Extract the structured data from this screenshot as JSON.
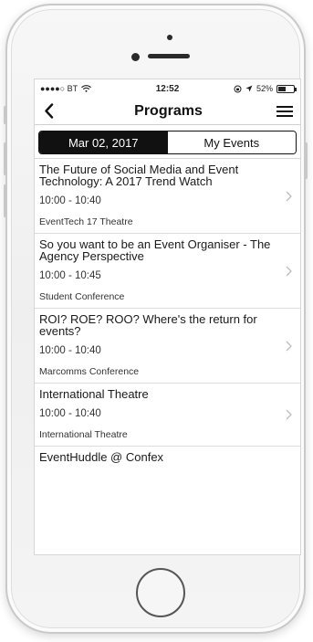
{
  "status_bar": {
    "carrier": "●●●●○ BT",
    "time": "12:52",
    "battery_percent": "52%",
    "battery_level": 0.52
  },
  "nav": {
    "title": "Programs",
    "back_icon": "chevron-left-icon",
    "menu_icon": "hamburger-menu-icon"
  },
  "tabs": [
    {
      "label": "Mar 02, 2017",
      "active": true
    },
    {
      "label": "My Events",
      "active": false
    }
  ],
  "programs": [
    {
      "title": "The Future of Social Media and Event Technology: A 2017 Trend Watch",
      "time": "10:00 - 10:40",
      "venue": "EventTech 17 Theatre"
    },
    {
      "title": "So you want to be an Event Organiser - The Agency Perspective",
      "time": "10:00 - 10:45",
      "venue": "Student Conference"
    },
    {
      "title": "ROI? ROE? ROO? Where's the return for events?",
      "time": "10:00 - 10:40",
      "venue": "Marcomms Conference"
    },
    {
      "title": "International Theatre",
      "time": "10:00 - 10:40",
      "venue": "International Theatre"
    },
    {
      "title": "EventHuddle @ Confex",
      "time": "",
      "venue": ""
    }
  ],
  "colors": {
    "segment_active_bg": "#111111",
    "segment_active_text": "#ffffff",
    "divider": "#dcdcdc"
  }
}
